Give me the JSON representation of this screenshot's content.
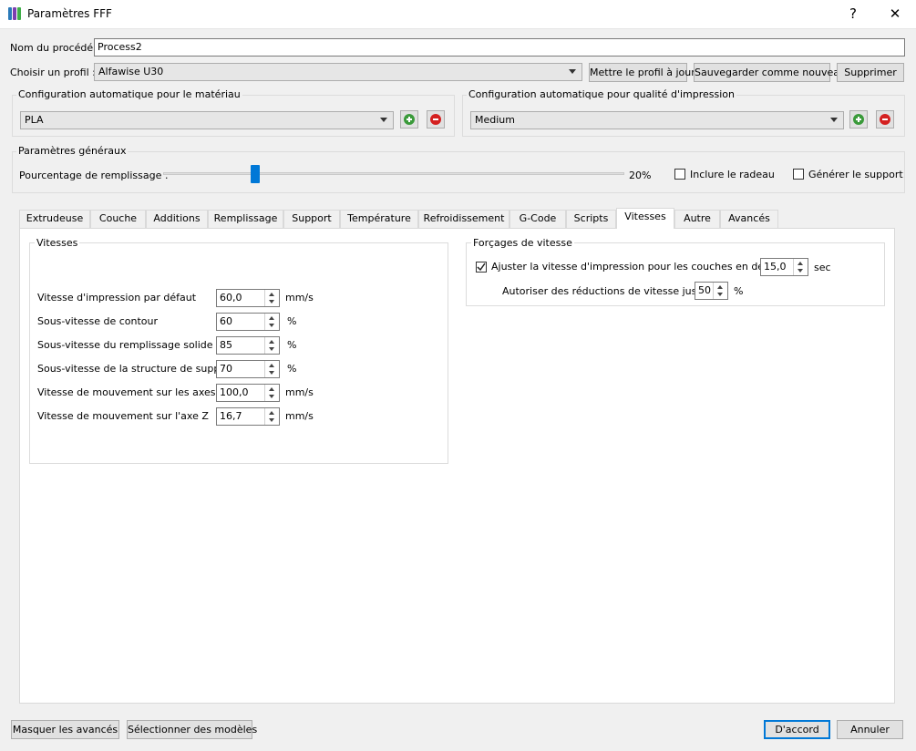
{
  "window": {
    "title": "Paramètres FFF",
    "help_label": "?",
    "close_label": "✕"
  },
  "process": {
    "name_label": "Nom du procédé :",
    "name_value": "Process2"
  },
  "profile": {
    "label": "Choisir un profil :",
    "selected": "Alfawise U30",
    "update_button": "Mettre le profil à jour",
    "save_new_button": "Sauvegarder comme nouveau",
    "delete_button": "Supprimer"
  },
  "material": {
    "title": "Configuration automatique pour le matériau",
    "selected": "PLA"
  },
  "quality": {
    "title": "Configuration automatique pour qualité d'impression",
    "selected": "Medium"
  },
  "general": {
    "title": "Paramètres généraux",
    "infill_label": "Pourcentage de remplissage :",
    "infill_value": "20%",
    "infill_fraction": 0.2,
    "raft_label": "Inclure le radeau",
    "raft_checked": false,
    "support_label": "Générer le support",
    "support_checked": false
  },
  "tabs": [
    {
      "label": "Extrudeuse"
    },
    {
      "label": "Couche"
    },
    {
      "label": "Additions"
    },
    {
      "label": "Remplissage"
    },
    {
      "label": "Support"
    },
    {
      "label": "Température"
    },
    {
      "label": "Refroidissement"
    },
    {
      "label": "G-Code"
    },
    {
      "label": "Scripts"
    },
    {
      "label": "Vitesses"
    },
    {
      "label": "Autre"
    },
    {
      "label": "Avancés"
    }
  ],
  "active_tab": "Vitesses",
  "speeds": {
    "title": "Vitesses",
    "rows": [
      {
        "label": "Vitesse d'impression par défaut",
        "value": "60,0",
        "unit": "mm/s"
      },
      {
        "label": "Sous-vitesse de contour",
        "value": "60",
        "unit": "%"
      },
      {
        "label": "Sous-vitesse du remplissage solide",
        "value": "85",
        "unit": "%"
      },
      {
        "label": "Sous-vitesse de la structure de support",
        "value": "70",
        "unit": "%"
      },
      {
        "label": "Vitesse de mouvement sur les axes X/Y",
        "value": "100,0",
        "unit": "mm/s"
      },
      {
        "label": "Vitesse de mouvement sur l'axe Z",
        "value": "16,7",
        "unit": "mm/s"
      }
    ]
  },
  "overrides": {
    "title": "Forçages de vitesse",
    "adjust_label": "Ajuster la vitesse d'impression pour les couches en dessous",
    "adjust_checked": true,
    "adjust_value": "15,0",
    "adjust_unit": "sec",
    "reduce_label": "Autoriser des réductions de vitesse jusqu'à",
    "reduce_value": "50",
    "reduce_unit": "%"
  },
  "footer": {
    "hide_advanced": "Masquer les avancés",
    "select_models": "Sélectionner des modèles",
    "ok": "D'accord",
    "cancel": "Annuler"
  },
  "colors": {
    "accent": "#0078d7",
    "add_green": "#3a9a3a",
    "remove_red": "#d42020"
  }
}
